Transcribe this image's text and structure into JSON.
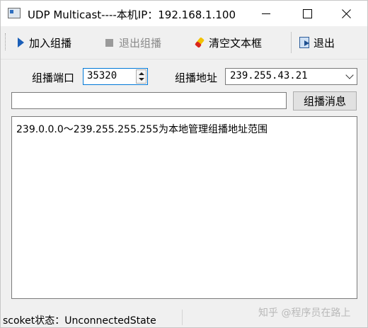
{
  "window": {
    "title": "UDP Multicast----本机IP：192.168.1.100"
  },
  "toolbar": {
    "join_label": "加入组播",
    "leave_label": "退出组播",
    "clear_label": "清空文本框",
    "exit_label": "退出"
  },
  "form": {
    "port_label": "组播端口",
    "port_value": "35320",
    "address_label": "组播地址",
    "address_value": "239.255.43.21",
    "message_value": "",
    "send_button_label": "组播消息"
  },
  "log": {
    "lines": [
      "239.0.0.0～239.255.255.255为本地管理组播地址范围"
    ]
  },
  "status": {
    "text": "scoket状态：UnconnectedState"
  },
  "watermark": "知乎 @程序员在路上",
  "icons": {
    "app": "app-window-icon",
    "join": "play-icon",
    "leave": "stop-icon",
    "clear": "eraser-icon",
    "exit": "exit-door-icon"
  },
  "colors": {
    "accent": "#0078d7",
    "play": "#1b5fb8",
    "disabled_text": "#8a8a8a"
  }
}
